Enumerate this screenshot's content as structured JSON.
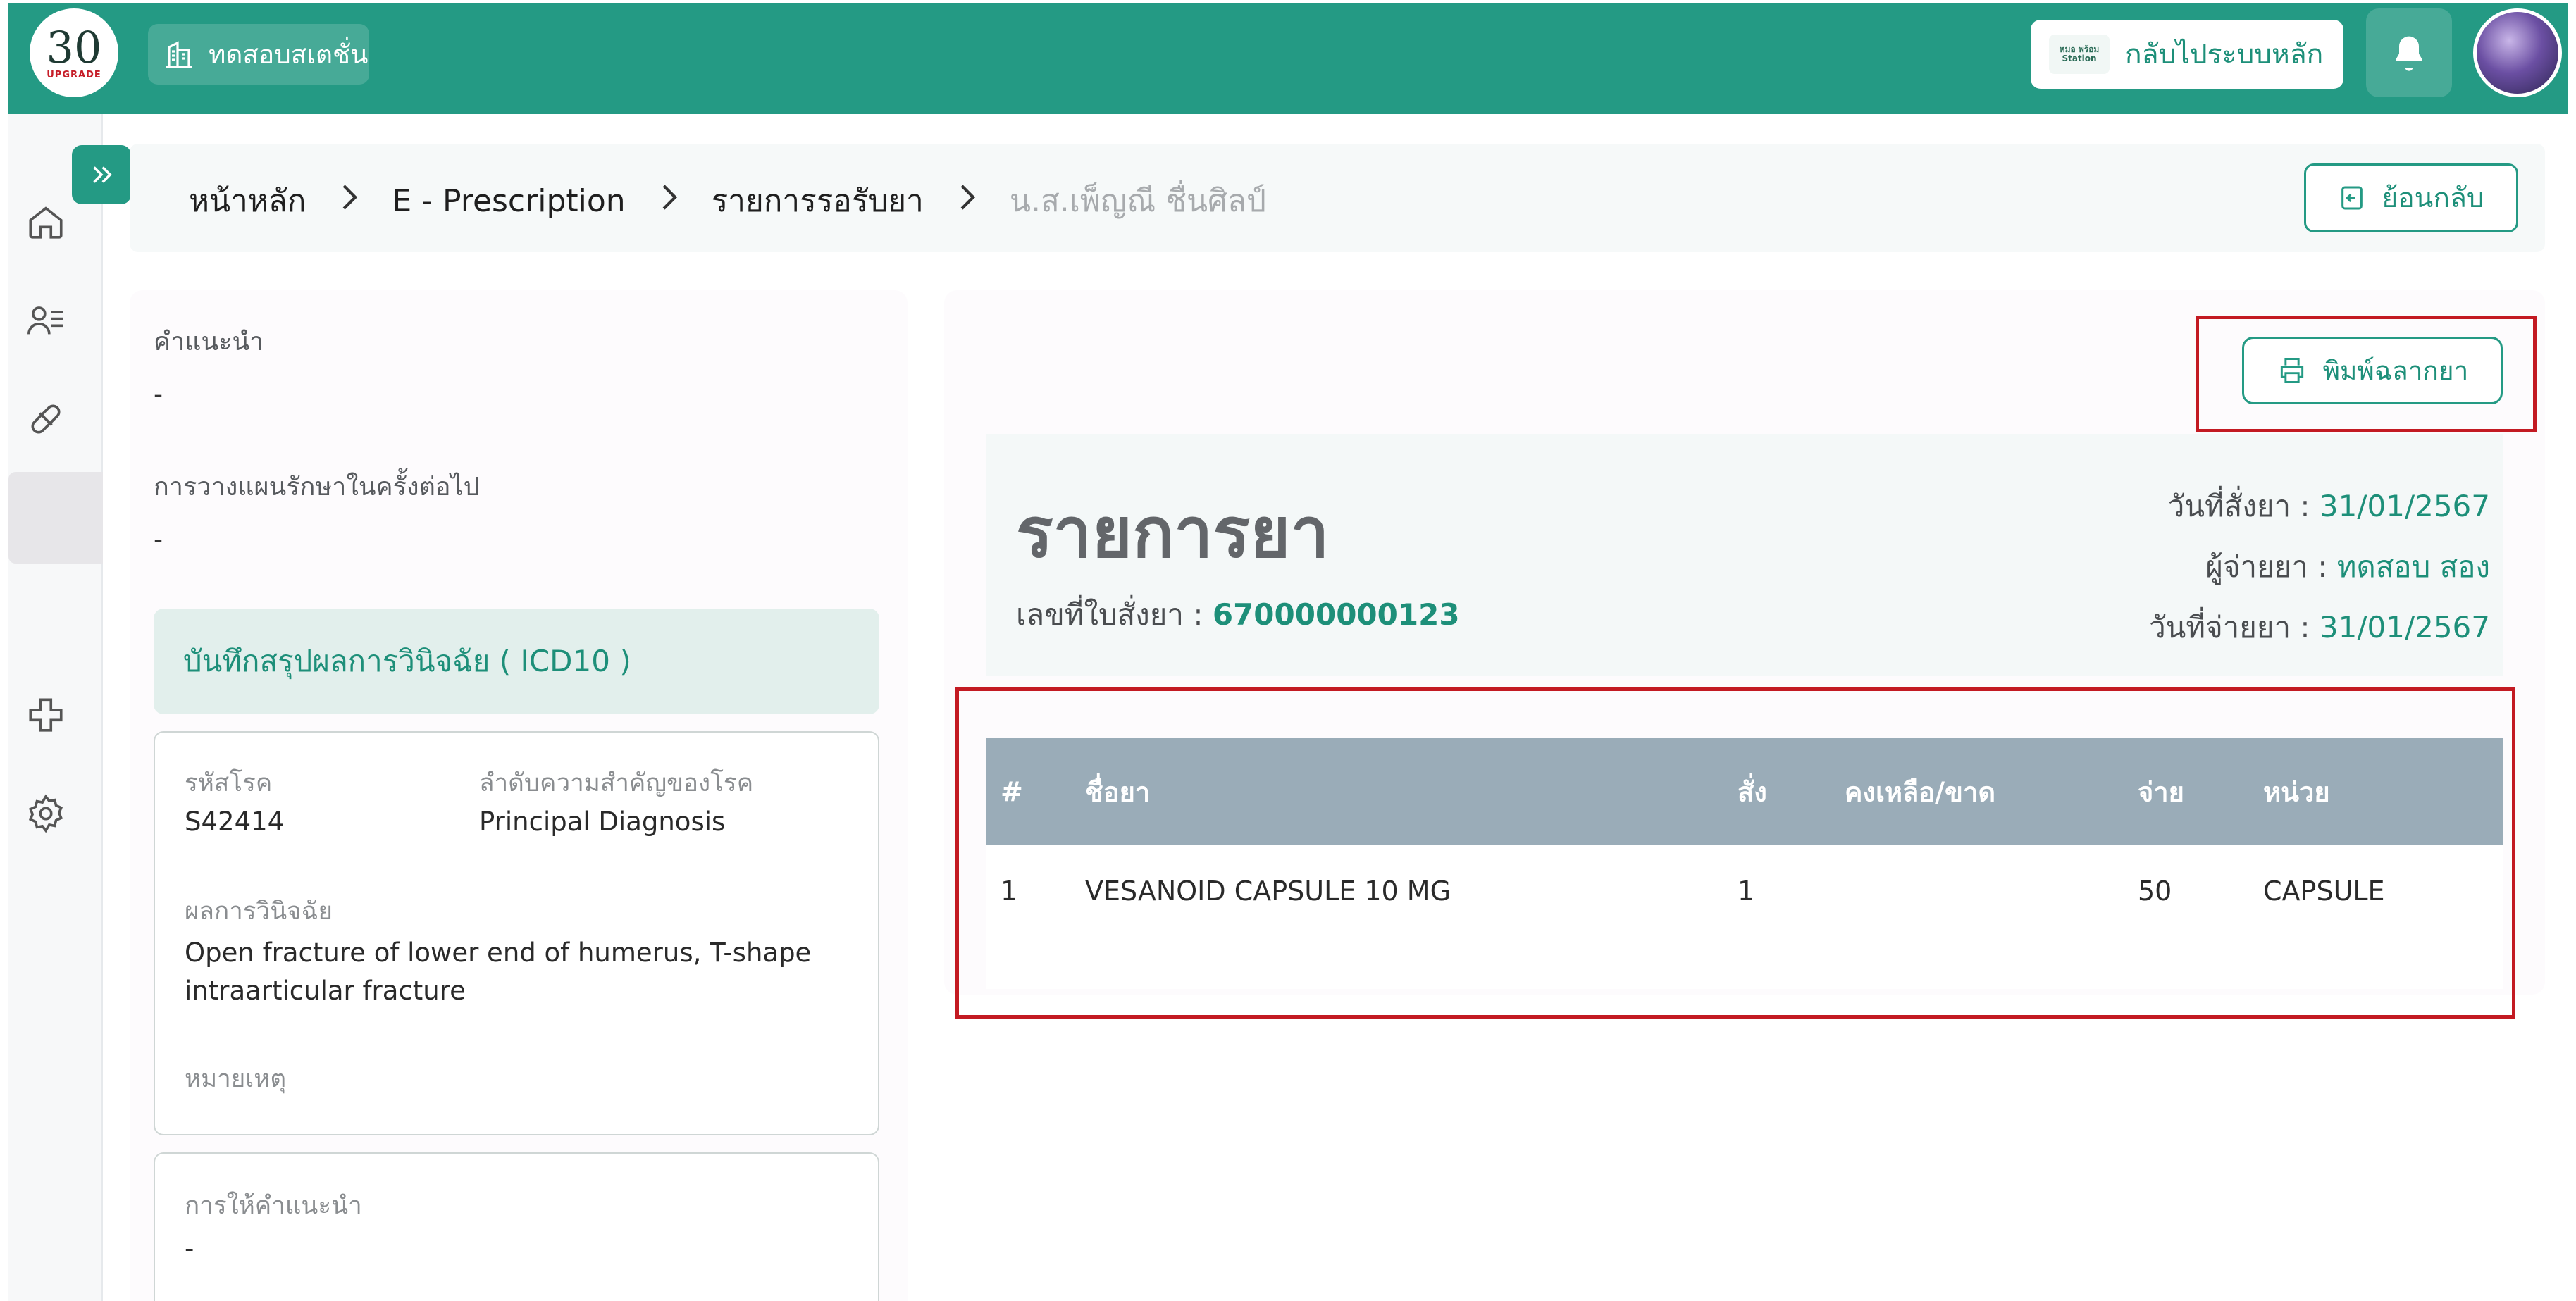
{
  "header": {
    "logo_number": "30",
    "logo_caption": "UPGRADE",
    "station_label": "ทดสอบสเตชั่น",
    "mini_logo_text": "หมอ พร้อม Station",
    "back_to_main_label": "กลับไประบบหลัก"
  },
  "breadcrumb": {
    "items": [
      "หน้าหลัก",
      "E - Prescription",
      "รายการรอรับยา"
    ],
    "current": "น.ส.เพ็ญณี ชื่นศิลป์"
  },
  "back_button_label": "ย้อนกลับ",
  "left_panel": {
    "advice_label": "คำแนะนำ",
    "advice_value": "-",
    "plan_label": "การวางแผนรักษาในครั้งต่อไป",
    "plan_value": "-",
    "icd_title": "บันทึกสรุปผลการวินิจฉัย ( ICD10 )",
    "diagnosis": {
      "code_label": "รหัสโรค",
      "code_value": "S42414",
      "priority_label": "ลำดับความสำคัญของโรค",
      "priority_value": "Principal Diagnosis",
      "result_label": "ผลการวินิจฉัย",
      "result_value": "Open fracture of lower end of humerus, T-shape intraarticular fracture",
      "note_label": "หมายเหตุ"
    },
    "counsel_label": "การให้คำแนะนำ",
    "counsel_value": "-"
  },
  "prescription": {
    "print_label": "พิมพ์ฉลากยา",
    "title": "รายการยา",
    "number_label": "เลขที่ใบสั่งยา : ",
    "number_value": "670000000123",
    "order_date_label": "วันที่สั่งยา : ",
    "order_date_value": "31/01/2567",
    "dispenser_label": "ผู้จ่ายยา : ",
    "dispenser_value": "ทดสอบ สอง",
    "dispense_date_label": "วันที่จ่ายยา : ",
    "dispense_date_value": "31/01/2567",
    "columns": [
      "#",
      "ชื่อยา",
      "สั่ง",
      "คงเหลือ/ขาด",
      "จ่าย",
      "หน่วย"
    ],
    "rows": [
      {
        "no": "1",
        "name": "VESANOID CAPSULE 10 MG",
        "ordered": "1",
        "remaining": "",
        "dispensed": "50",
        "unit": "CAPSULE"
      }
    ]
  },
  "colors": {
    "primary": "#249a84",
    "highlight_border": "#c31a22",
    "table_header": "#9aacb8"
  }
}
